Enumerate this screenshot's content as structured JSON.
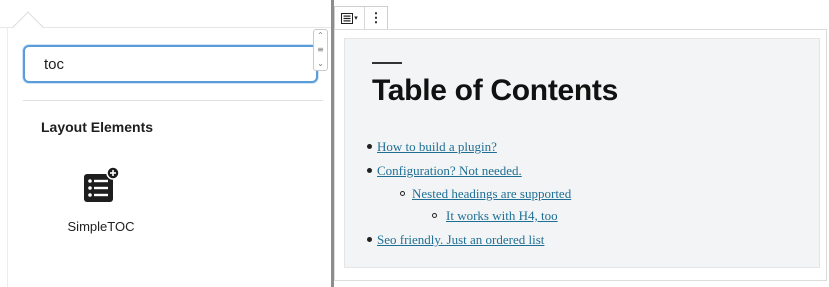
{
  "inserter": {
    "search_value": "toc",
    "group_title": "Layout Elements",
    "blocks": [
      {
        "label": "SimpleTOC",
        "icon": "list-with-plus-icon"
      }
    ],
    "scroll_up_glyph": "⌃",
    "scroll_mid_glyph": "≡",
    "scroll_down_glyph": "⌄"
  },
  "toolbar": {
    "block_type_icon": "table-of-contents-icon",
    "block_type_caret": "▾",
    "more_options_glyph": "⋮"
  },
  "editor": {
    "heading": "Table of Contents",
    "items": [
      {
        "text": "How to build a plugin?",
        "level": 1
      },
      {
        "text": "Configuration? Not needed.",
        "level": 1
      },
      {
        "text": "Nested headings are supported",
        "level": 2
      },
      {
        "text": "It works with H4, too",
        "level": 3
      },
      {
        "text": "Seo friendly. Just an ordered list",
        "level": 1
      }
    ]
  },
  "colors": {
    "link": "#1f6f95",
    "focus": "#5b9dd9",
    "canvas_bg": "#f3f4f5"
  }
}
